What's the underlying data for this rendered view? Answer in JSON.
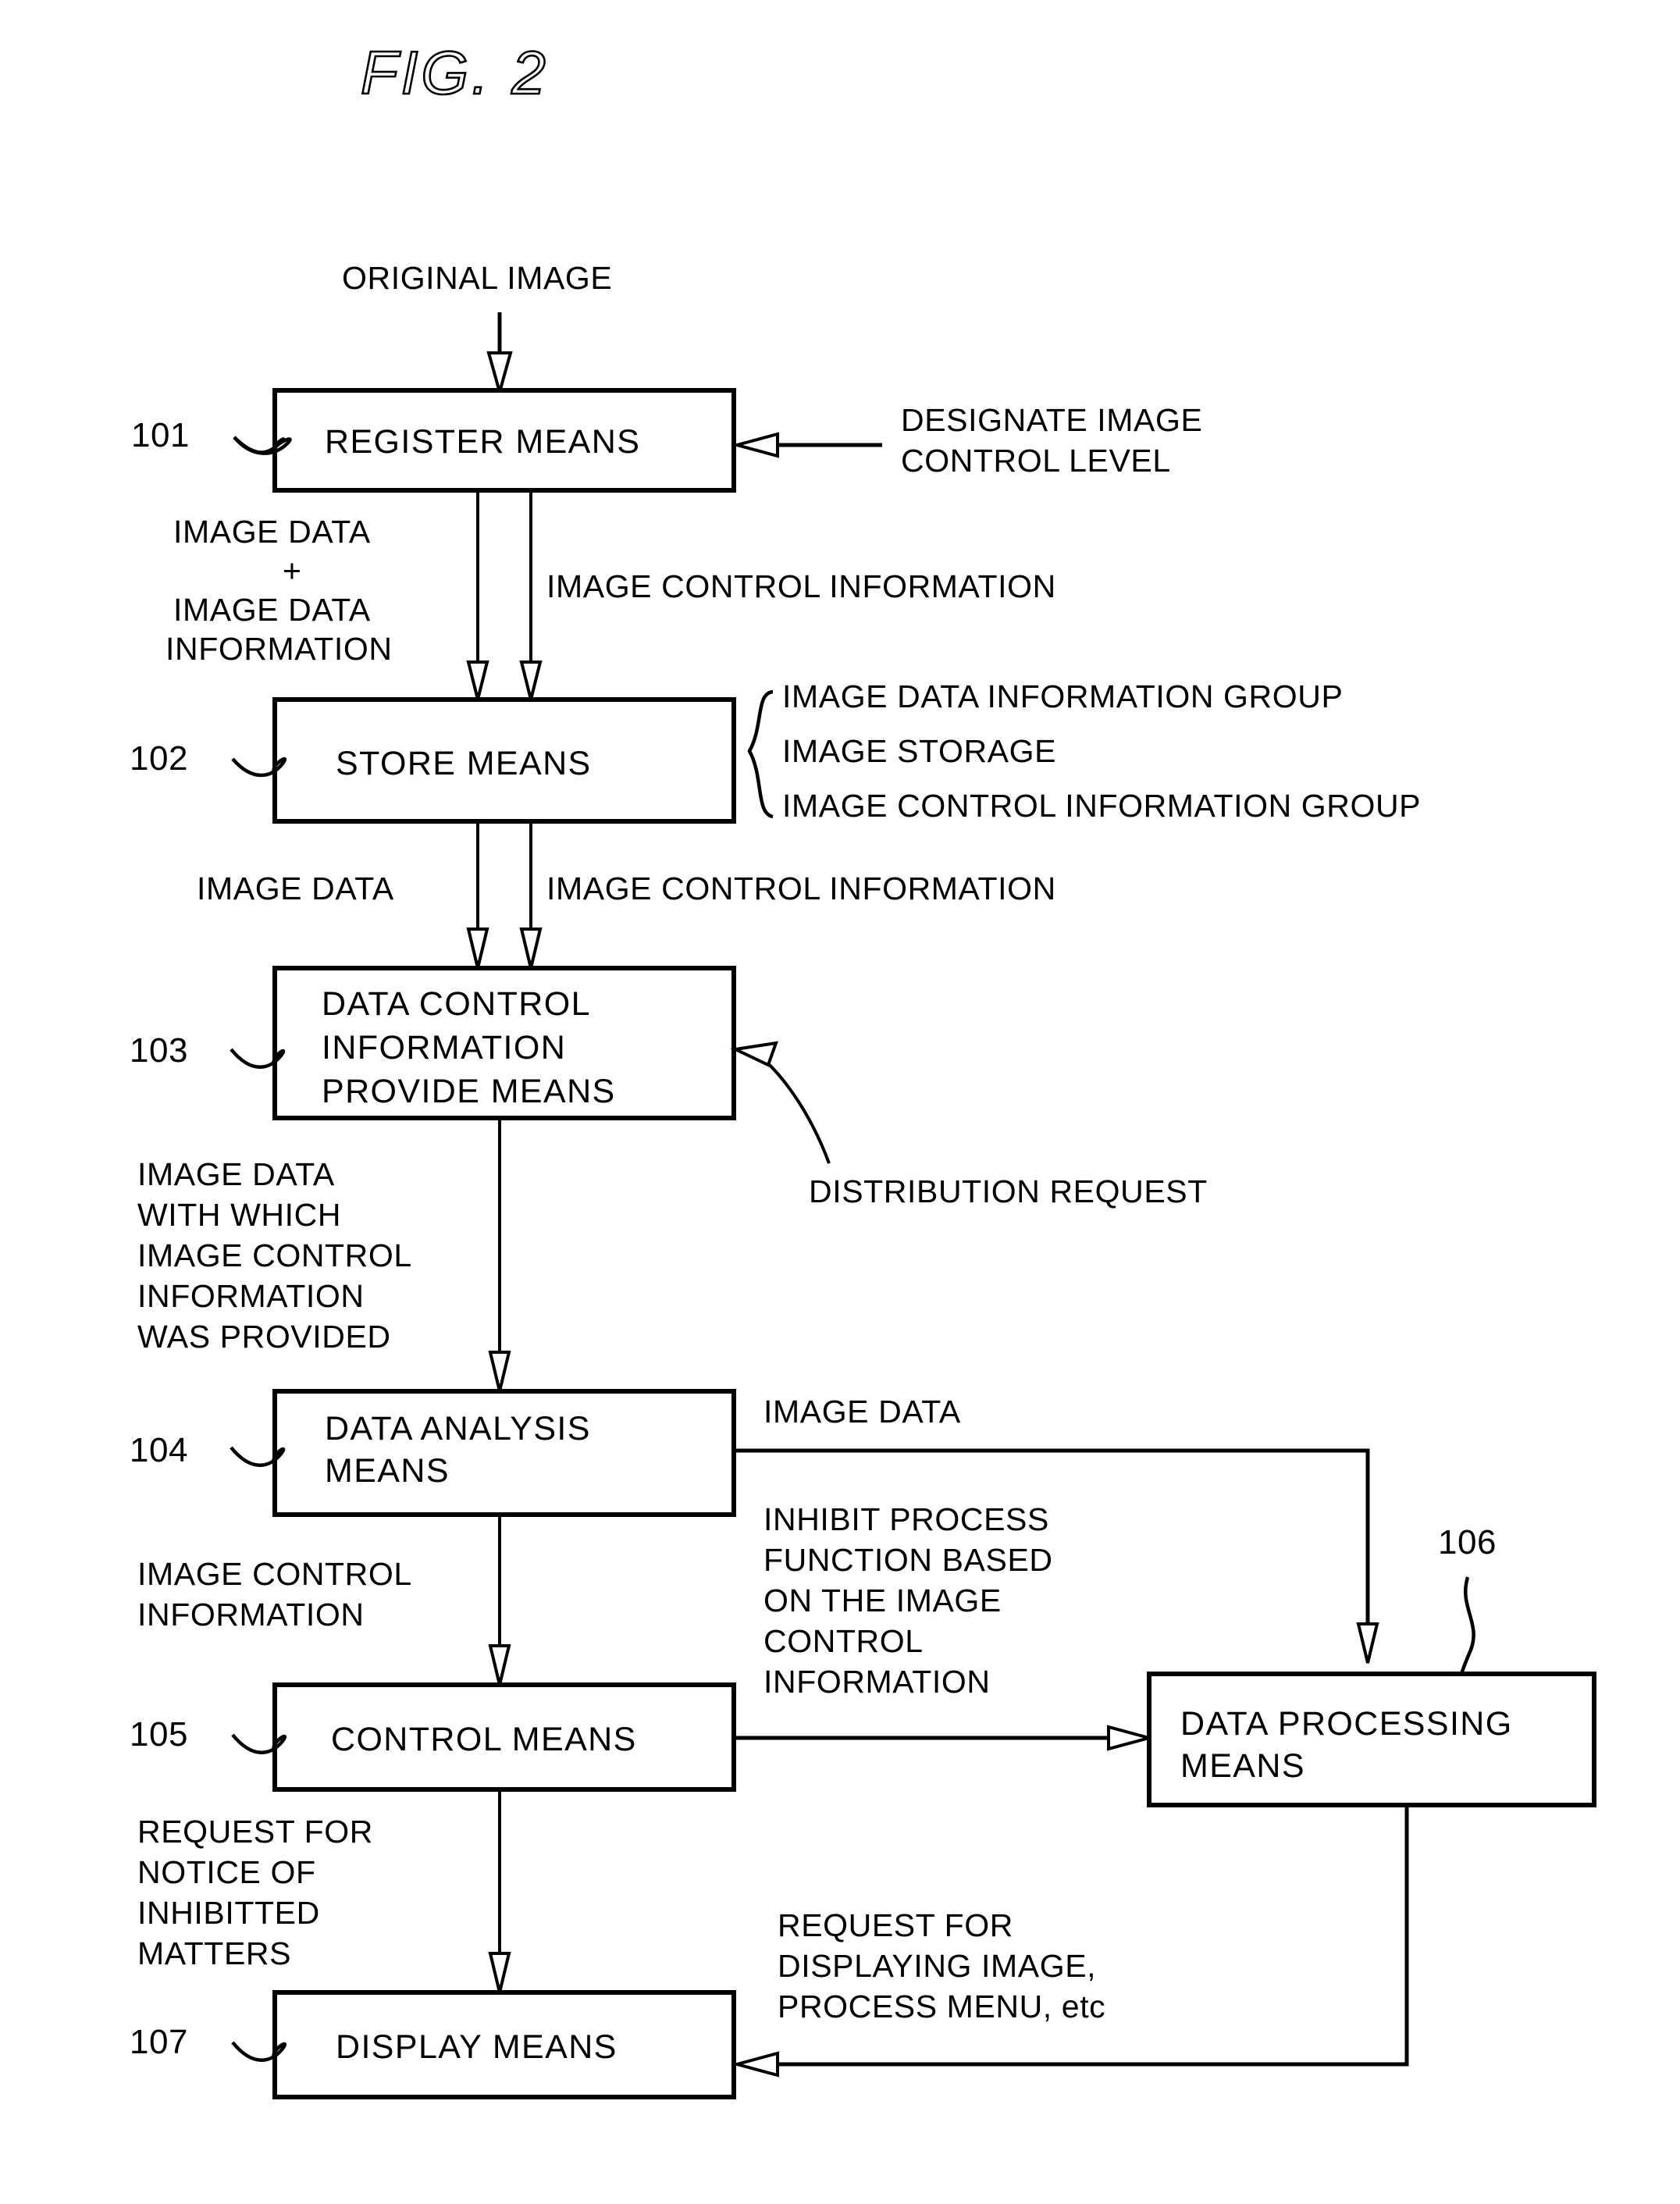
{
  "figure": {
    "title": "FIG. 2"
  },
  "boxes": [
    {
      "ref": "101",
      "label": "REGISTER MEANS"
    },
    {
      "ref": "102",
      "label": "STORE MEANS"
    },
    {
      "ref": "103",
      "label_line1": "DATA CONTROL",
      "label_line2": "INFORMATION",
      "label_line3": "PROVIDE MEANS"
    },
    {
      "ref": "104",
      "label_line1": "DATA ANALYSIS",
      "label_line2": "MEANS"
    },
    {
      "ref": "105",
      "label": "CONTROL MEANS"
    },
    {
      "ref": "106",
      "label_line1": "DATA PROCESSING",
      "label_line2": "MEANS"
    },
    {
      "ref": "107",
      "label": "DISPLAY MEANS"
    }
  ],
  "labels": {
    "original_image": "ORIGINAL IMAGE",
    "designate_image_line1": "DESIGNATE IMAGE",
    "designate_image_line2": "CONTROL LEVEL",
    "image_data_plus_line1": "IMAGE DATA",
    "image_data_plus_line2": "+",
    "image_data_plus_line3": "IMAGE DATA",
    "image_data_plus_line4": "INFORMATION",
    "image_control_information_1": "IMAGE CONTROL INFORMATION",
    "store_brace_line1": "IMAGE DATA INFORMATION GROUP",
    "store_brace_line2": "IMAGE STORAGE",
    "store_brace_line3": "IMAGE CONTROL INFORMATION GROUP",
    "image_data_2": "IMAGE DATA",
    "image_control_information_2": "IMAGE CONTROL INFORMATION",
    "provided_line1": "IMAGE DATA",
    "provided_line2": "WITH WHICH",
    "provided_line3": "IMAGE CONTROL",
    "provided_line4": "INFORMATION",
    "provided_line5": "WAS PROVIDED",
    "distribution_request": "DISTRIBUTION REQUEST",
    "image_data_3": "IMAGE DATA",
    "image_control_information_line1": "IMAGE CONTROL",
    "image_control_information_line2": "INFORMATION",
    "inhibit_line1": "INHIBIT PROCESS",
    "inhibit_line2": "FUNCTION BASED",
    "inhibit_line3": "ON THE IMAGE",
    "inhibit_line4": "CONTROL",
    "inhibit_line5": "INFORMATION",
    "notice_line1": "REQUEST FOR",
    "notice_line2": "NOTICE OF",
    "notice_line3": "INHIBITTED",
    "notice_line4": "MATTERS",
    "display_req_line1": "REQUEST FOR",
    "display_req_line2": "DISPLAYING IMAGE,",
    "display_req_line3": "PROCESS MENU, etc"
  },
  "colors": {
    "ink": "#000000",
    "paper": "#ffffff"
  }
}
